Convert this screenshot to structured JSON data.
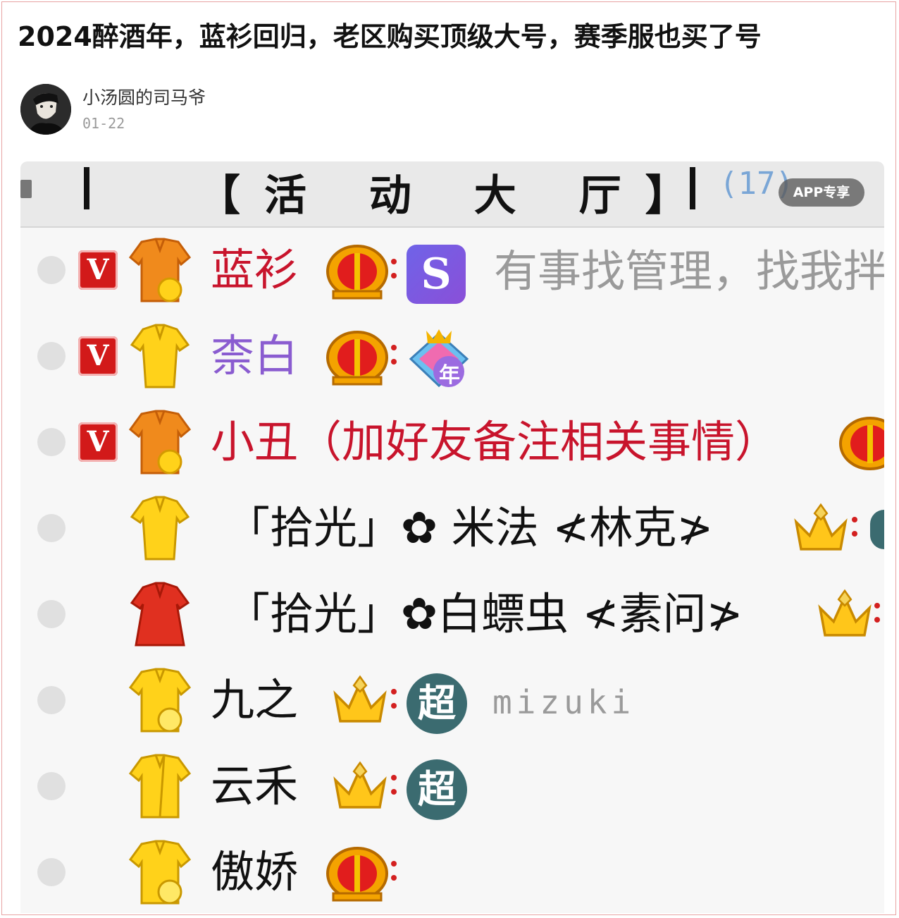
{
  "post": {
    "title": "2024醉酒年，蓝衫回归，老区购买顶级大号，赛季服也买了号",
    "author": "小汤圆的司马爷",
    "date": "01-22"
  },
  "screenshot": {
    "hall_title": "【活 动 大 厅】",
    "count": "(17)",
    "app_badge": "APP专享",
    "members": [
      {
        "name": "蓝衫",
        "signature": "有事找管理，找我拌"
      },
      {
        "name": "柰白",
        "year_badge": "年"
      },
      {
        "name": "小丑（加好友备注相关事情）"
      },
      {
        "name": "「拾光」✿ 米法 ≮林克≯"
      },
      {
        "name": "「拾光」✿白螵虫 ≮素问≯"
      },
      {
        "name": "九之",
        "badge": "超",
        "signature": "mizuki"
      },
      {
        "name": "云禾",
        "badge": "超"
      },
      {
        "name": "傲娇"
      }
    ],
    "vip_label": "V",
    "s_badge": "S"
  },
  "colors": {
    "name_red": "#c8142c",
    "name_purple": "#8a5cd0",
    "name_black": "#111111",
    "vip_red": "#d21a1a"
  }
}
